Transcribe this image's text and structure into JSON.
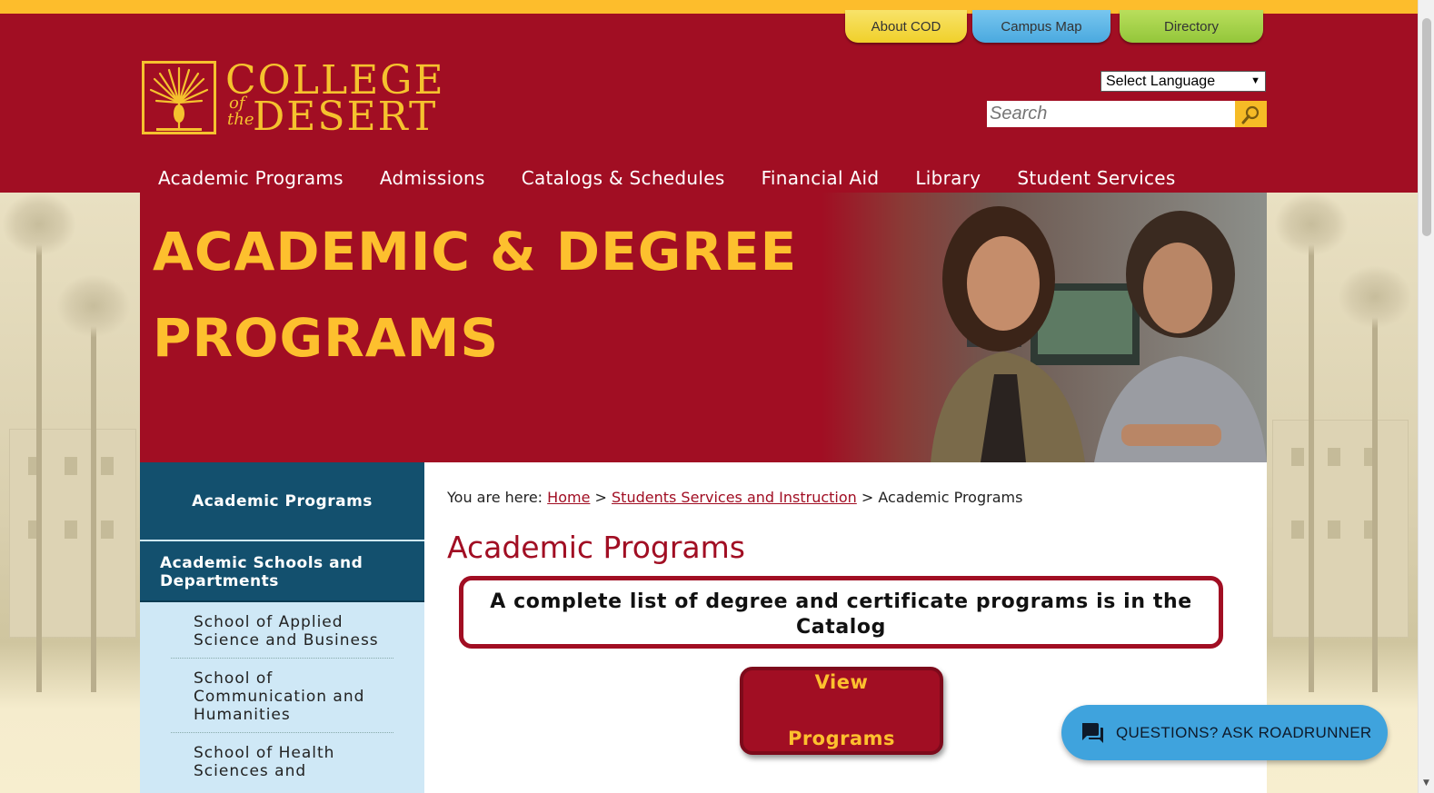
{
  "topbar": {
    "tabs": [
      {
        "label": "About COD",
        "color": "#f0d02a"
      },
      {
        "label": "Campus Map",
        "color": "#4aa9df"
      },
      {
        "label": "Directory",
        "color": "#93c63a"
      }
    ]
  },
  "brand": {
    "college": "COLLEGE",
    "of": "of",
    "the": "the",
    "desert": "DESERT",
    "colors": {
      "primary": "#a10e23",
      "accent": "#fdc02e",
      "sidebar_dark": "#13506e",
      "sidebar_light": "#cfe8f6"
    }
  },
  "header": {
    "language_select": "Select Language",
    "search_placeholder": "Search",
    "search_icon": "search-icon"
  },
  "nav": {
    "items": [
      "Academic Programs",
      "Admissions",
      "Catalogs & Schedules",
      "Financial Aid",
      "Library",
      "Student Services"
    ]
  },
  "hero": {
    "line1": "ACADEMIC & DEGREE",
    "line2": "PROGRAMS"
  },
  "sidebar": {
    "heading": "Academic Programs",
    "subheading": "Academic Schools and Departments",
    "items": [
      "School of Applied Science and Business",
      "School of Communication and Humanities",
      "School of Health Sciences and"
    ]
  },
  "breadcrumb": {
    "prefix": "You are here:",
    "home": "Home",
    "sep": ">",
    "section": "Students Services and Instruction",
    "current": "Academic Programs"
  },
  "main": {
    "title": "Academic Programs",
    "notice": "A complete list of degree and certificate programs is in the Catalog",
    "button_line1": "View",
    "button_line2": "Programs"
  },
  "chat": {
    "label": "QUESTIONS? ASK ROADRUNNER",
    "icon": "chat-icon"
  }
}
